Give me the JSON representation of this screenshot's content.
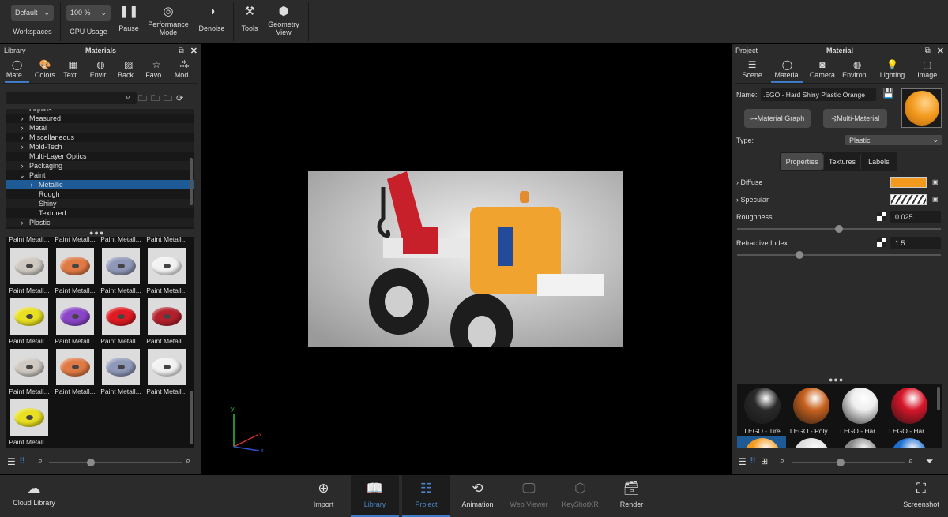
{
  "toolbar": {
    "workspace_value": "Default",
    "workspace_label": "Workspaces",
    "cpu_value": "100 %",
    "cpu_label": "CPU Usage",
    "pause": "Pause",
    "performance": "Performance Mode",
    "denoise": "Denoise",
    "tools": "Tools",
    "geometry_view": "Geometry View"
  },
  "library": {
    "panel_title": "Library",
    "header": "Materials",
    "tabs": [
      "Mate...",
      "Colors",
      "Text...",
      "Envir...",
      "Back...",
      "Favo...",
      "Mod..."
    ],
    "search_placeholder": "",
    "tree": [
      {
        "label": "Liquids",
        "level": 1,
        "arrow": ""
      },
      {
        "label": "Measured",
        "level": 1,
        "arrow": ">"
      },
      {
        "label": "Metal",
        "level": 1,
        "arrow": ">"
      },
      {
        "label": "Miscellaneous",
        "level": 1,
        "arrow": ">"
      },
      {
        "label": "Mold-Tech",
        "level": 1,
        "arrow": ">"
      },
      {
        "label": "Multi-Layer Optics",
        "level": 1,
        "arrow": ""
      },
      {
        "label": "Packaging",
        "level": 1,
        "arrow": ">"
      },
      {
        "label": "Paint",
        "level": 1,
        "arrow": "v"
      },
      {
        "label": "Metallic",
        "level": 2,
        "arrow": ">",
        "selected": true
      },
      {
        "label": "Rough",
        "level": 2,
        "arrow": ""
      },
      {
        "label": "Shiny",
        "level": 2,
        "arrow": ""
      },
      {
        "label": "Textured",
        "level": 2,
        "arrow": ""
      },
      {
        "label": "Plastic",
        "level": 1,
        "arrow": ">"
      }
    ],
    "top_labels": [
      "Paint Metall...",
      "Paint Metall...",
      "Paint Metall...",
      "Paint Metall..."
    ],
    "items": [
      {
        "label": "Paint Metall...",
        "color": "#cfc9c2"
      },
      {
        "label": "Paint Metall...",
        "color": "#e07a45"
      },
      {
        "label": "Paint Metall...",
        "color": "#8f98b8"
      },
      {
        "label": "Paint Metall...",
        "color": "#f2f2f2"
      },
      {
        "label": "Paint Metall...",
        "color": "#e8e020"
      },
      {
        "label": "Paint Metall...",
        "color": "#8a45c8"
      },
      {
        "label": "Paint Metall...",
        "color": "#e01a22"
      },
      {
        "label": "Paint Metall...",
        "color": "#b3202c"
      },
      {
        "label": "Paint Metall...",
        "color": "#cfc9c2"
      },
      {
        "label": "Paint Metall...",
        "color": "#e07a45"
      },
      {
        "label": "Paint Metall...",
        "color": "#8f98b8"
      },
      {
        "label": "Paint Metall...",
        "color": "#f2f2f2"
      },
      {
        "label": "Paint Metall...",
        "color": "#e8e020"
      }
    ]
  },
  "viewport": {
    "axis_x": "x",
    "axis_y": "y",
    "axis_z": "z"
  },
  "project": {
    "panel_title": "Project",
    "header": "Material",
    "tabs": [
      "Scene",
      "Material",
      "Camera",
      "Environ...",
      "Lighting",
      "Image"
    ],
    "name_label": "Name:",
    "name_value": ".EGO - Hard Shiny Plastic Orange",
    "material_graph": "Material Graph",
    "multi_material": "Multi-Material",
    "type_label": "Type:",
    "type_value": "Plastic",
    "subtabs": [
      "Properties",
      "Textures",
      "Labels"
    ],
    "diffuse": "Diffuse",
    "diffuse_color": "#f39a1e",
    "specular": "Specular",
    "roughness_label": "Roughness",
    "roughness_value": "0.025",
    "roughness_fraction": 0.5,
    "refractive_label": "Refractive Index",
    "refractive_value": "1.5",
    "refractive_fraction": 0.3,
    "materials": [
      {
        "label": "LEGO - Tire",
        "color": "#2a2a2a"
      },
      {
        "label": "LEGO - Poly...",
        "color": "#c8621e"
      },
      {
        "label": "LEGO - Har...",
        "color": "#eeeeee"
      },
      {
        "label": "LEGO - Har...",
        "color": "#d8162a"
      }
    ]
  },
  "bottom": {
    "cloud_library": "Cloud Library",
    "items": [
      "Import",
      "Library",
      "Project",
      "Animation",
      "Web Viewer",
      "KeyShotXR",
      "Render"
    ],
    "screenshot": "Screenshot"
  }
}
